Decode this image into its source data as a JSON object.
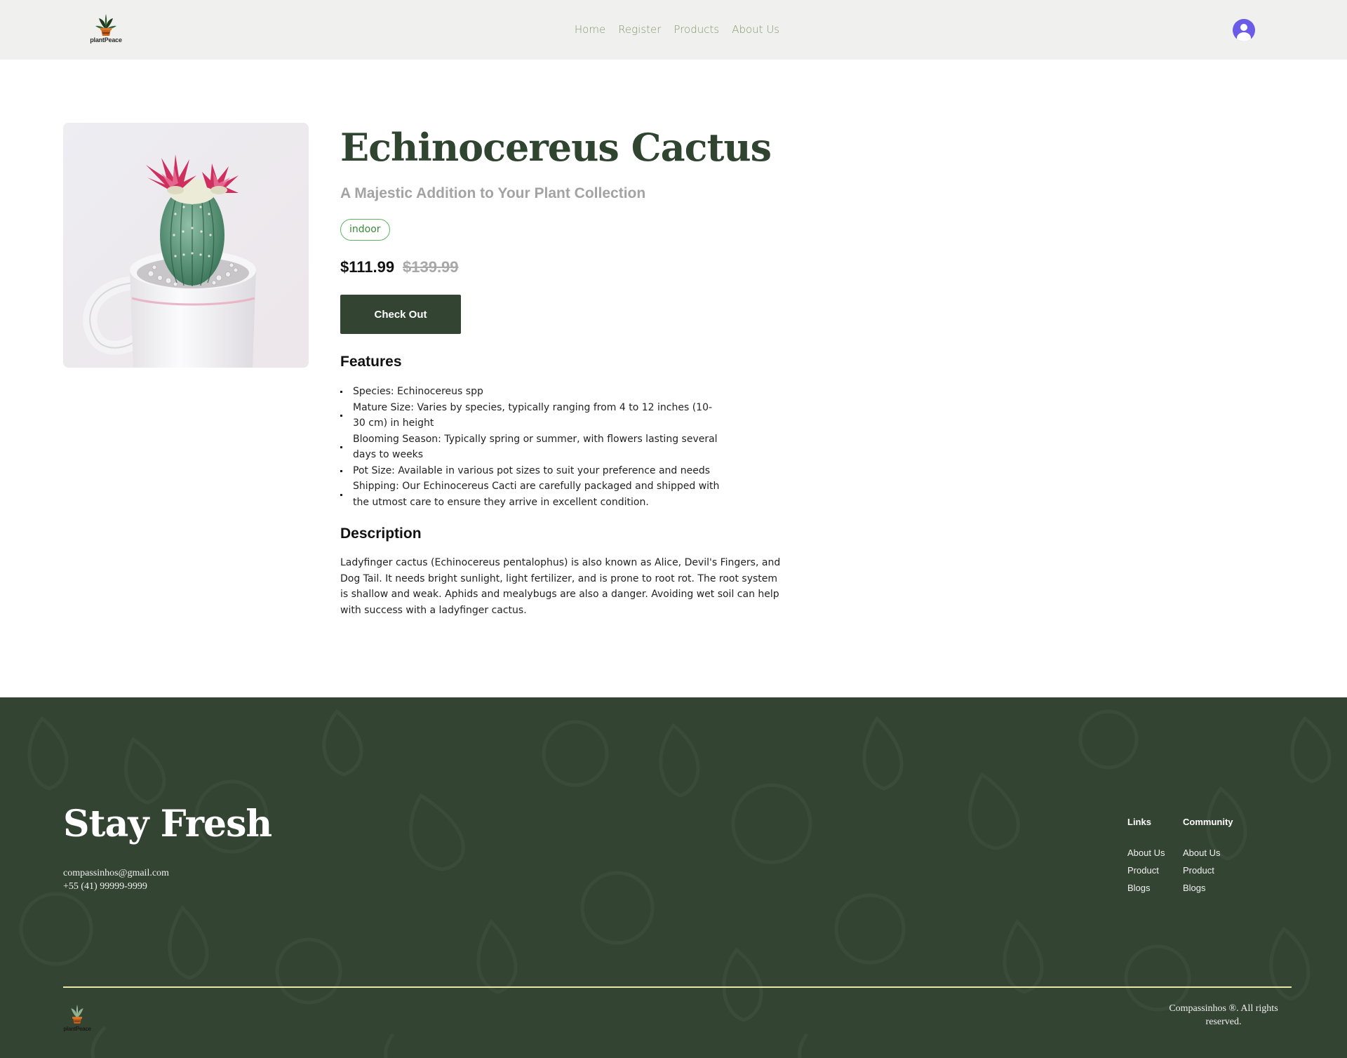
{
  "header": {
    "logo_text": "plantPeace",
    "nav": [
      "Home",
      "Register",
      "Products",
      "About Us"
    ]
  },
  "product": {
    "title": "Echinocereus Cactus",
    "subtitle": "A Majestic Addition to Your Plant Collection",
    "tag": "indoor",
    "price": "$111.99",
    "old_price": "$139.99",
    "checkout_label": "Check Out",
    "features_heading": "Features",
    "features": [
      "Species: Echinocereus spp",
      "Mature Size: Varies by species, typically ranging from 4 to 12 inches (10-30 cm) in height",
      "Blooming Season: Typically spring or summer, with flowers lasting several days to weeks",
      "Pot Size: Available in various pot sizes to suit your preference and needs",
      "Shipping: Our Echinocereus Cacti are carefully packaged and shipped with the utmost care to ensure they arrive in excellent condition."
    ],
    "description_heading": "Description",
    "description": "Ladyfinger cactus (Echinocereus pentalophus) is also known as Alice, Devil's Fingers, and Dog Tail. It needs bright sunlight, light fertilizer, and is prone to root rot. The root system is shallow and weak. Aphids and mealybugs are also a danger. Avoiding wet soil can help with success with a ladyfinger cactus."
  },
  "footer": {
    "title": "Stay Fresh",
    "email": "compassinhos@gmail.com",
    "phone": "+55 (41) 99999-9999",
    "links": {
      "heading": "Links",
      "items": [
        "About Us",
        "Product",
        "Blogs"
      ]
    },
    "community": {
      "heading": "Community",
      "items": [
        "About Us",
        "Product",
        "Blogs"
      ]
    },
    "logo_text": "plantPeace",
    "copyright": "Compassinhos ®. All rights reserved."
  },
  "colors": {
    "header_bg": "#f0f0ee",
    "nav_text": "#87976e",
    "title": "#2f4530",
    "button_bg": "#344433",
    "footer_bg": "#344433",
    "footer_rule": "#e7e5a8",
    "tag_border": "#5fb55f",
    "avatar": "#6b5ce7"
  },
  "icons": {
    "logo": "plant-pot-logo-icon",
    "avatar": "user-avatar-icon"
  }
}
